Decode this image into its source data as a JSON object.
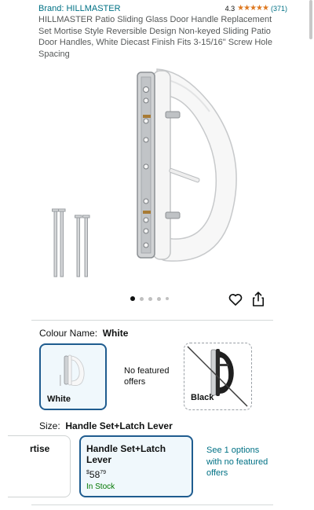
{
  "header": {
    "brand": "Brand: HILLMASTER",
    "rating_value": "4.3",
    "rating_stars": "★★★★★",
    "rating_count": "(371)",
    "title": "HILLMASTER Patio Sliding Glass Door Handle Replacement Set Mortise Style Reversible Design Non-keyed Sliding Patio Door Handles, White Diecast Finish Fits 3-15/16\" Screw Hole Spacing"
  },
  "gallery": {
    "dots_total": 5,
    "active_index": 0,
    "icons": [
      "heart-icon",
      "share-icon"
    ]
  },
  "colour": {
    "label": "Colour Name:",
    "selected": "White",
    "options": [
      {
        "name": "White",
        "selected": true
      },
      {
        "name": "No featured offers",
        "selected": false
      },
      {
        "name": "Black",
        "selected": false
      }
    ]
  },
  "size": {
    "label": "Size:",
    "selected": "Handle Set+Latch Lever",
    "options": [
      {
        "name": "rtise"
      },
      {
        "name": "Handle Set+Latch Lever",
        "price_symbol": "$",
        "price_whole": "58",
        "price_fraction": "79",
        "availability": "In Stock",
        "selected": true
      },
      {
        "name": "See 1 options with no featured offers"
      }
    ]
  },
  "colors": {
    "link": "#007185",
    "accent_border": "#1f5c8f",
    "in_stock": "#007600",
    "star": "#de7921"
  }
}
